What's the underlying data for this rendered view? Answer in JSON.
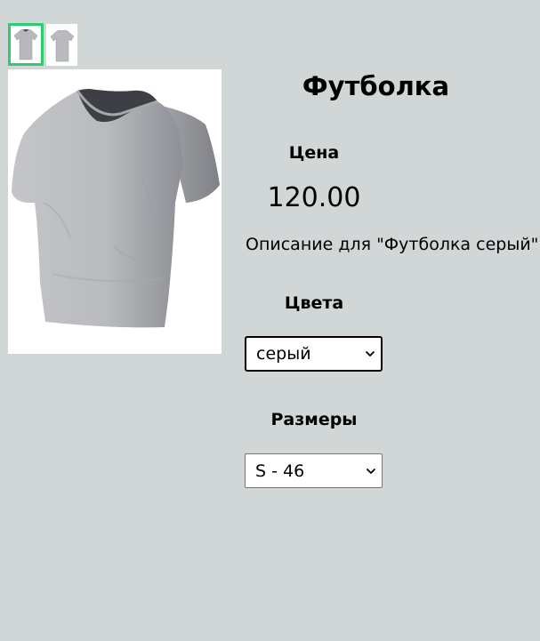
{
  "product": {
    "title": "Футболка",
    "price_label": "Цена",
    "price": "120.00",
    "description": "Описание для \"Футболка серый\"",
    "colors_label": "Цвета",
    "color_selected": "серый",
    "sizes_label": "Размеры",
    "size_selected": "S - 46"
  },
  "gallery": {
    "thumbnails": [
      {
        "name": "thumbnail-front",
        "selected": true
      },
      {
        "name": "thumbnail-back",
        "selected": false
      }
    ]
  },
  "icons": {
    "select_arrow": "chevron-down-icon"
  },
  "colors": {
    "background": "#d1d6d7",
    "thumbnail_selected_border": "#2ecc71",
    "shirt_gray": "#b6b8bc"
  }
}
